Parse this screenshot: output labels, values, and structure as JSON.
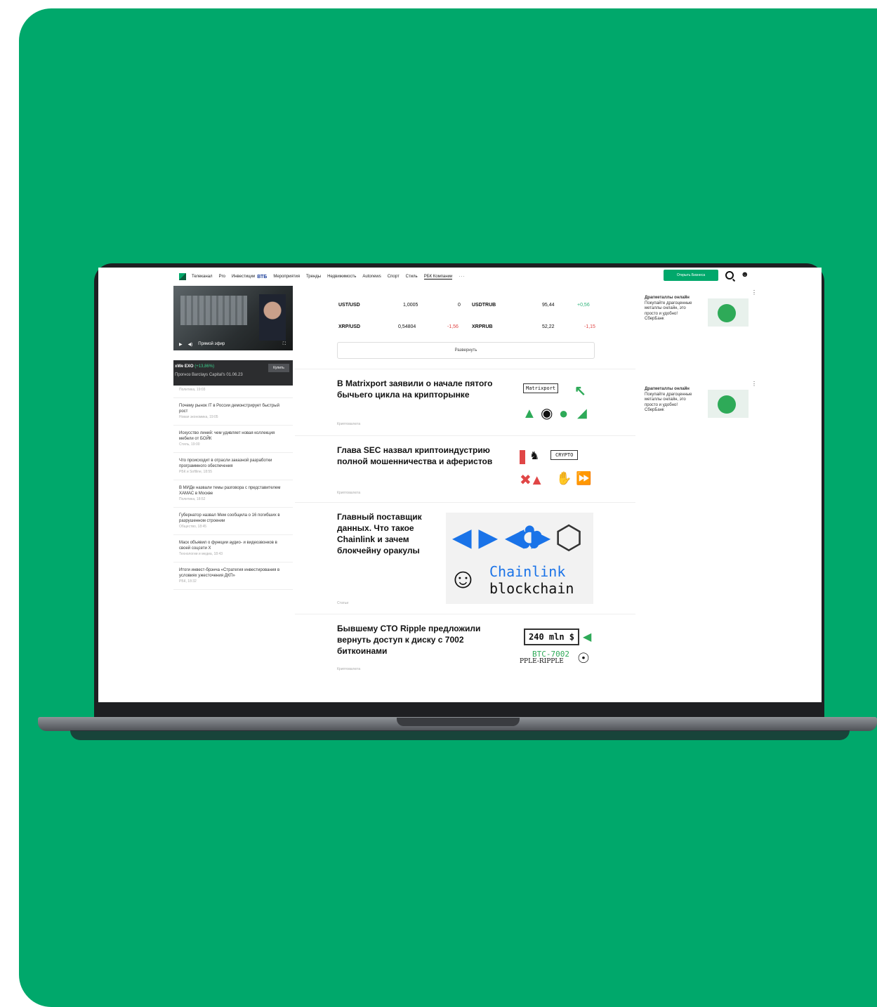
{
  "nav": {
    "items": [
      "Телеканал",
      "Pro",
      "Инвестиции",
      "Мероприятия",
      "Тренды",
      "Недвижимость",
      "Autonews",
      "Спорт",
      "Стиль",
      "РБК Компании"
    ],
    "vtb_label": "ВТБ",
    "more": "···",
    "open_button": "Открыть Бизнеса"
  },
  "video": {
    "live_label": "Прямой эфир",
    "ticker_name": "xWe EXO",
    "ticker_change": "(+13,86%)",
    "ticker_sub": "Прогноз Barclays Capital's 01.06.23",
    "buy_label": "Купить"
  },
  "news": [
    {
      "title": "",
      "meta": "Политика, 19:03"
    },
    {
      "title": "Почему рынок IT в России демонстрирует быстрый рост",
      "meta": "Новая экономика, 19:05"
    },
    {
      "title": "Искусство линий: чем удивляет новая коллекция мебели от БОЙК",
      "meta": "Стиль, 19:00"
    },
    {
      "title": "Что происходит в отрасли заказной разработки программного обеспечения",
      "meta": "РБК и Softline, 18:55"
    },
    {
      "title": "В МИДе назвали темы разговора с представителем ХАМАС в Москве",
      "meta": "Политика, 18:52"
    },
    {
      "title": "Губернатор назвал Мем сообщила о 16 погибших в разрушенном строении",
      "meta": "Общество, 18:45"
    },
    {
      "title": "Маск объявил о функции аудио- и видеозвонков в своей соцсети X",
      "meta": "Технологии и медиа, 18:43"
    },
    {
      "title": "Итоги инвест-брэнча «Стратегия инвестирования в условиях ужесточения ДКП»",
      "meta": "РБК, 18:32"
    }
  ],
  "rates": {
    "row1": {
      "a_name": "UST/USD",
      "a_val": "1,0005",
      "a_chg": "0",
      "b_name": "USDTRUB",
      "b_val": "95,44",
      "b_chg": "+0,56"
    },
    "row2": {
      "a_name": "XRP/USD",
      "a_val": "0,54804",
      "a_chg": "-1,56",
      "b_name": "XRPRUB",
      "b_val": "52,22",
      "b_chg": "-1,15"
    },
    "expand": "Развернуть"
  },
  "articles": [
    {
      "title": "В Matrixport заявили о начале пятого бычьего цикла на крипторынке",
      "cat": "Криптовалюта",
      "pic_text": "Matrixport"
    },
    {
      "title": "Глава SEC назвал криптоиндустрию полной мошенничества и аферистов",
      "cat": "Криптовалюта",
      "pic_text": "CRYPTO"
    },
    {
      "title": "Главный поставщик данных. Что такое Chainlink и зачем блокчейну оракулы",
      "cat": "Статьи",
      "pic_line1": "Chainlink",
      "pic_line2": "blockchain"
    },
    {
      "title": "Бывшему CTO Ripple предложили вернуть доступ к диску с 7002 биткоинами",
      "cat": "Криптовалюта",
      "pic_line1": "240 mln $",
      "pic_line2": "BTC-7002",
      "pic_line3": "PPLE-RIPPLE"
    }
  ],
  "ads": [
    {
      "heading": "Драгметаллы онлайн",
      "body": "Покупайте драгоценные металлы онлайн, это просто и удобно! СберБанк"
    },
    {
      "heading": "Драгметаллы онлайн",
      "body": "Покупайте драгоценные металлы онлайн, это просто и удобно! СберБанк"
    }
  ],
  "colors": {
    "background": "#00a86b",
    "accent": "#00a86b",
    "up": "#2db37a",
    "down": "#e04646"
  }
}
